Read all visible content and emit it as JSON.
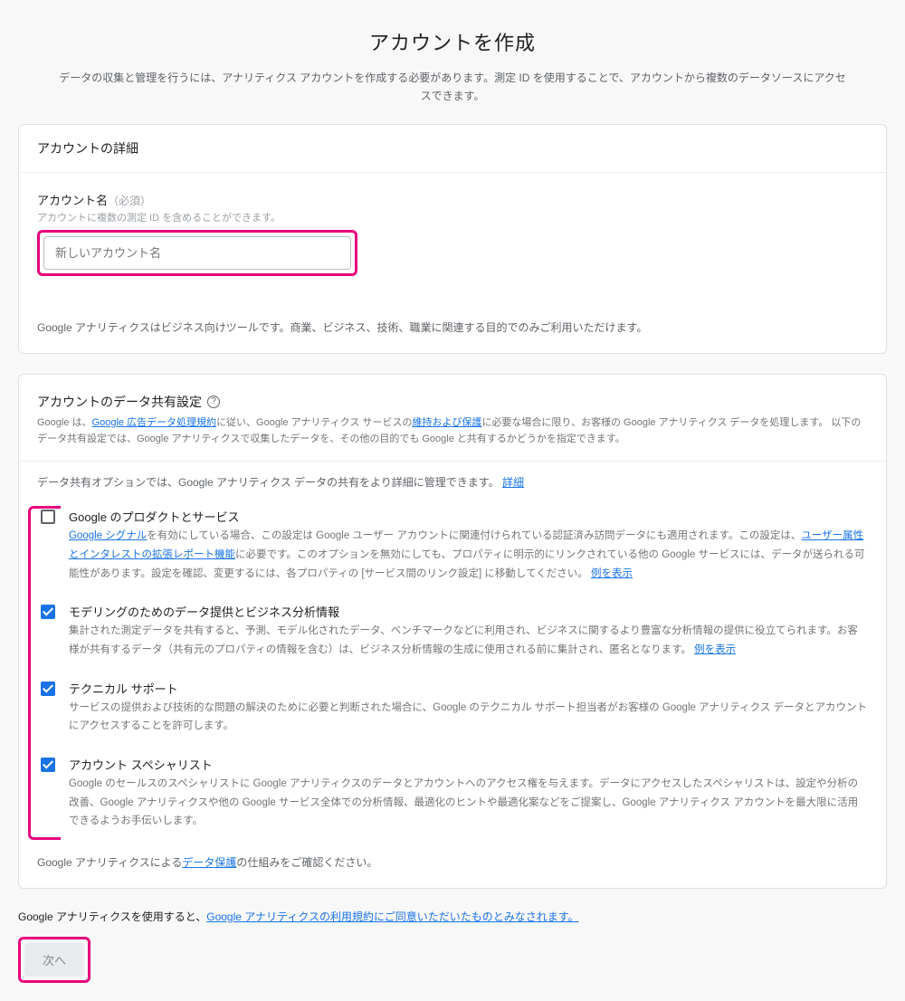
{
  "header": {
    "title": "アカウントを作成",
    "subtitle": "データの収集と管理を行うには、アナリティクス アカウントを作成する必要があります。測定 ID を使用することで、アカウントから複数のデータソースにアクセスできます。"
  },
  "details": {
    "section_title": "アカウントの詳細",
    "name_label": "アカウント名",
    "required_text": "（必須）",
    "name_help": "アカウントに複数の測定 ID を含めることができます。",
    "name_placeholder": "新しいアカウント名",
    "business_note": "Google アナリティクスはビジネス向けツールです。商業、ビジネス、技術、職業に関連する目的でのみご利用いただけます。"
  },
  "share": {
    "section_title": "アカウントのデータ共有設定",
    "intro_prefix": "Google は、",
    "intro_link1": "Google 広告データ処理規約",
    "intro_mid1": "に従い、Google アナリティクス サービスの",
    "intro_link2": "維持および保護",
    "intro_suffix": "に必要な場合に限り、お客様の Google アナリティクス データを処理します。  以下のデータ共有設定では、Google アナリティクスで収集したデータを、その他の目的でも Google と共有するかどうかを指定できます。",
    "option_note_prefix": "データ共有オプションでは、Google アナリティクス データの共有をより詳細に管理できます。",
    "option_note_link": "詳細",
    "options": [
      {
        "checked": false,
        "title": "Google のプロダクトとサービス",
        "desc_a": "",
        "link_a": "Google シグナル",
        "desc_mid": "を有効にしている場合、この設定は Google ユーザー アカウントに関連付けられている認証済み訪問データにも適用されます。この設定は、",
        "link_b": "ユーザー属性とインタレストの拡張レポート機能",
        "desc_b": "に必要です。このオプションを無効にしても、プロパティに明示的にリンクされている他の Google サービスには、データが送られる可能性があります。設定を確認、変更するには、各プロパティの [サービス間のリンク設定] に移動してください。",
        "link_c": "例を表示"
      },
      {
        "checked": true,
        "title": "モデリングのためのデータ提供とビジネス分析情報",
        "desc_a": "集計された測定データを共有すると、予測、モデル化されたデータ、ベンチマークなどに利用され、ビジネスに関するより豊富な分析情報の提供に役立てられます。お客様が共有するデータ（共有元のプロパティの情報を含む）は、ビジネス分析情報の生成に使用される前に集計され、匿名となります。",
        "link_a": "例を表示"
      },
      {
        "checked": true,
        "title": "テクニカル サポート",
        "desc_a": "サービスの提供および技術的な問題の解決のために必要と判断された場合に、Google のテクニカル サポート担当者がお客様の Google アナリティクス データとアカウントにアクセスすることを許可します。"
      },
      {
        "checked": true,
        "title": "アカウント スペシャリスト",
        "desc_a": "Google のセールスのスペシャリストに Google アナリティクスのデータとアカウントへのアクセス権を与えます。データにアクセスしたスペシャリストは、設定や分析の改善、Google アナリティクスや他の Google サービス全体での分析情報、最適化のヒントや最適化案などをご提案し、Google アナリティクス アカウントを最大限に活用できるようお手伝いします。"
      }
    ],
    "data_protect_prefix": "Google アナリティクスによる",
    "data_protect_link": "データ保護",
    "data_protect_suffix": "の仕組みをご確認ください。"
  },
  "terms": {
    "prefix": "Google アナリティクスを使用すると、",
    "link": "Google アナリティクスの利用規約にご同意いただいたものとみなされます。"
  },
  "next_label": "次へ"
}
